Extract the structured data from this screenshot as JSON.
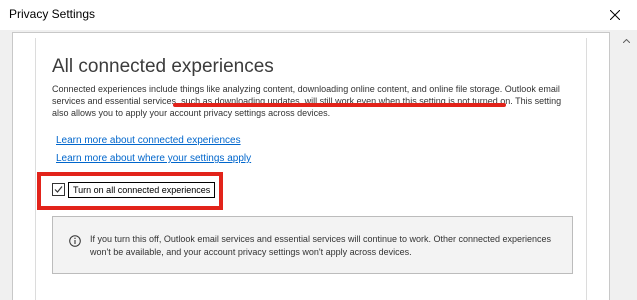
{
  "window": {
    "title": "Privacy Settings"
  },
  "section": {
    "heading": "All connected experiences",
    "description_before": "Connected experiences include things like analyzing content, downloading online content, and online file storage. Outlook email services and essential services, ",
    "description_highlight": "such as downloading updates, will still work even when this setting is not turned on",
    "description_after": ". This setting also allows you to apply your account privacy settings across devices."
  },
  "links": {
    "learn_more": "Learn more about connected experiences",
    "where_applied": "Learn more about where your settings apply"
  },
  "checkbox": {
    "label": "Turn on all connected experiences",
    "checked": true
  },
  "info": {
    "text": "If you turn this off, Outlook email services and essential services will continue to work. Other connected experiences won't be available, and your account privacy settings won't apply across devices."
  },
  "colors": {
    "annotation": "#e2231a",
    "link": "#0066cc"
  },
  "icons": {
    "close": "close-icon",
    "scroll_up": "scroll-up-icon",
    "check": "checkmark-icon",
    "info": "info-icon"
  }
}
